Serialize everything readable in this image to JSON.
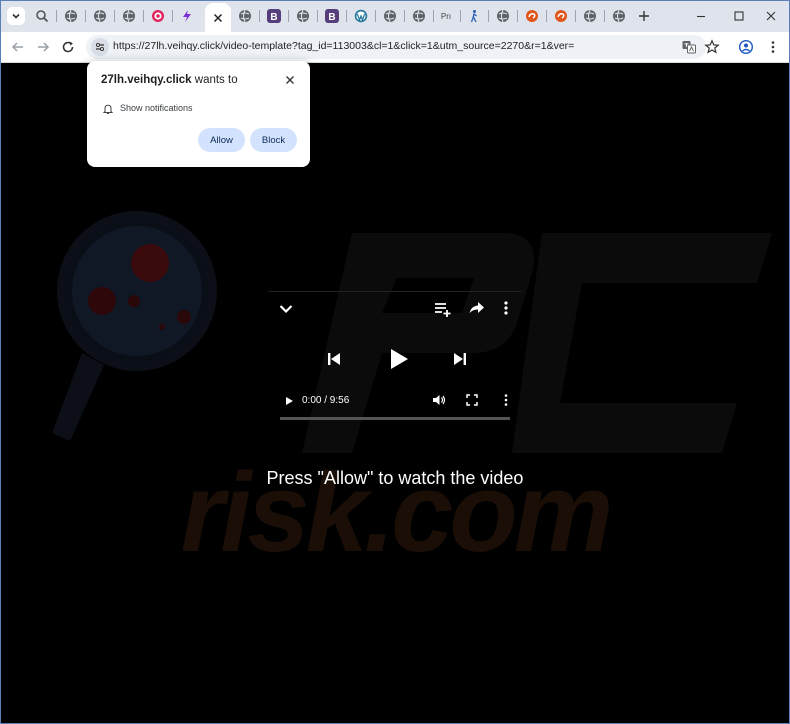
{
  "tabs": [
    {
      "icon": "tab-search-icon"
    },
    {
      "icon": "search-favicon-icon"
    },
    {
      "icon": "globe-icon"
    },
    {
      "icon": "globe-icon"
    },
    {
      "icon": "globe-icon"
    },
    {
      "icon": "target-favicon-icon"
    },
    {
      "icon": "bolt-favicon-icon"
    },
    {
      "icon": "close-icon",
      "active": true
    },
    {
      "icon": "globe-icon"
    },
    {
      "icon": "b-favicon-icon",
      "text": "B"
    },
    {
      "icon": "globe-icon"
    },
    {
      "icon": "b-favicon-icon",
      "text": "B"
    },
    {
      "icon": "wordpress-favicon-icon"
    },
    {
      "icon": "globe-icon"
    },
    {
      "icon": "pr-favicon-icon",
      "text": "Prı"
    },
    {
      "icon": "figure-favicon-icon"
    },
    {
      "icon": "globe-icon"
    },
    {
      "icon": "swirl-favicon-icon"
    },
    {
      "icon": "swirl-favicon-icon"
    },
    {
      "icon": "globe-icon"
    },
    {
      "icon": "globe-icon"
    }
  ],
  "address_bar": {
    "url": "https://27lh.veihqy.click/video-template?tag_id=113003&cl=1&click=1&utm_source=2270&r=1&ver="
  },
  "popup": {
    "site": "27lh.veihqy.click",
    "wants_to": "wants to",
    "permission": "Show notifications",
    "allow_label": "Allow",
    "block_label": "Block"
  },
  "player": {
    "time": "0:00 / 9:56",
    "progress": 0
  },
  "caption": "Press \"Allow\" to watch the video",
  "watermark": {
    "text": "risk.com"
  },
  "colors": {
    "tabstrip_bg": "#dee3ec",
    "allow_button_bg": "#d3e3fd",
    "page_bg": "#000000",
    "window_border": "#5b7fb8"
  }
}
